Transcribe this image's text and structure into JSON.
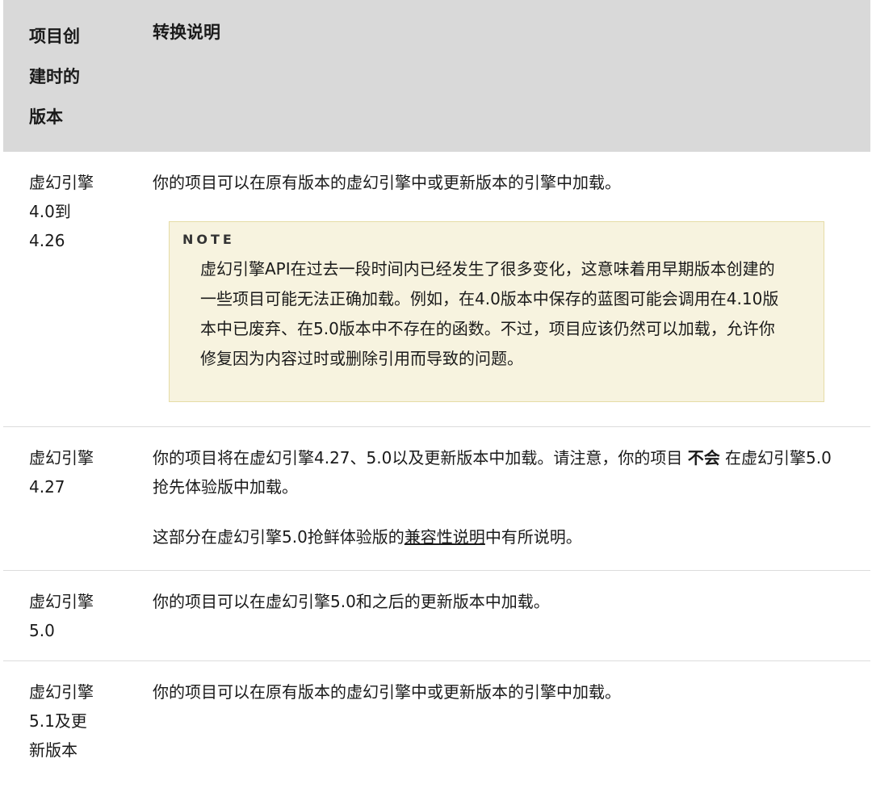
{
  "header": {
    "col1": [
      "项目创",
      "建时的",
      "版本"
    ],
    "col2": "转换说明"
  },
  "rows": [
    {
      "version": [
        "虚幻引擎",
        "4.0到",
        "4.26"
      ],
      "desc": "你的项目可以在原有版本的虚幻引擎中或更新版本的引擎中加载。",
      "note": {
        "label": "NOTE",
        "lines": [
          "虚幻引擎API在过去一段时间内已经发生了很多变化，这意味着用早期版本创建的",
          "一些项目可能无法正确加载。例如，在4.0版本中保存的蓝图可能会调用在4.10版",
          "本中已废弃、在5.0版本中不存在的函数。不过，项目应该仍然可以加载，允许你",
          "修复因为内容过时或删除引用而导致的问题。"
        ]
      }
    },
    {
      "version": [
        "虚幻引擎",
        "4.27"
      ],
      "desc_line1_pre": "你的项目将在虚幻引擎4.27、5.0以及更新版本中加载。请注意，你的项目 ",
      "desc_line1_strong": "不会",
      "desc_line1_post": " 在虚幻引擎5.0",
      "desc_line2": "抢先体验版中加载。",
      "para2_pre": "这部分在虚幻引擎5.0抢鲜体验版的",
      "para2_link": "兼容性说明",
      "para2_post": "中有所说明。"
    },
    {
      "version": [
        "虚幻引擎",
        "5.0"
      ],
      "desc": "你的项目可以在虚幻引擎5.0和之后的更新版本中加载。"
    },
    {
      "version": [
        "虚幻引擎",
        "5.1及更",
        "新版本"
      ],
      "desc": "你的项目可以在原有版本的虚幻引擎中或更新版本的引擎中加载。"
    }
  ]
}
